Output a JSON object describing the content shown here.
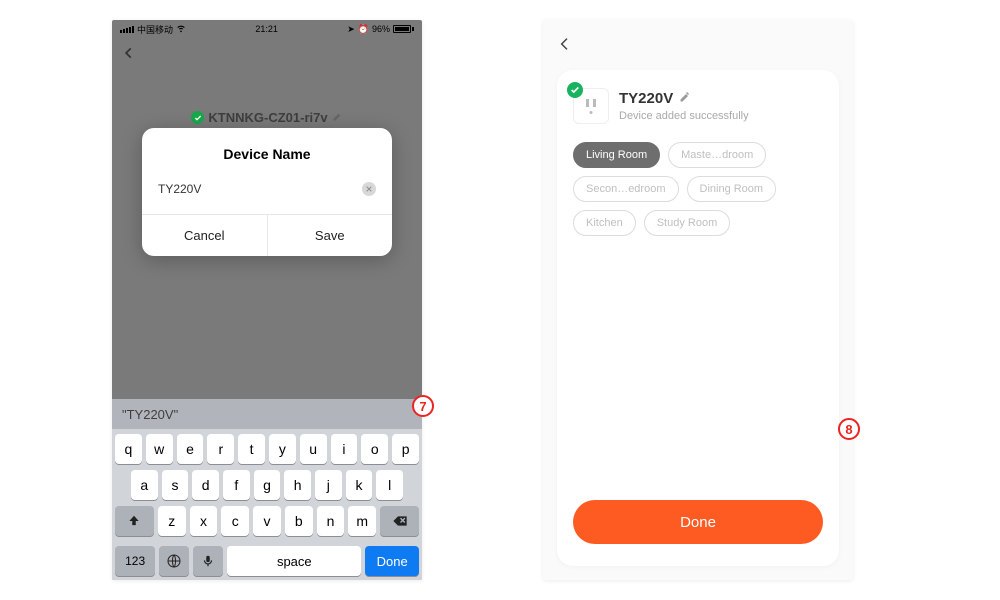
{
  "left": {
    "status": {
      "carrier": "中国移动",
      "time": "21:21",
      "battery_pct": "96%"
    },
    "bg_device_label": "KTNNKG-CZ01-ri7v",
    "modal": {
      "title": "Device Name",
      "value": "TY220V",
      "cancel": "Cancel",
      "save": "Save"
    },
    "keyboard": {
      "prediction": "\"TY220V\"",
      "row1": [
        "q",
        "w",
        "e",
        "r",
        "t",
        "y",
        "u",
        "i",
        "o",
        "p"
      ],
      "row2": [
        "a",
        "s",
        "d",
        "f",
        "g",
        "h",
        "j",
        "k",
        "l"
      ],
      "row3_letters": [
        "z",
        "x",
        "c",
        "v",
        "b",
        "n",
        "m"
      ],
      "num_key": "123",
      "space": "space",
      "done": "Done"
    }
  },
  "right": {
    "device_name": "TY220V",
    "device_sub": "Device added successfully",
    "rooms": [
      "Living Room",
      "Maste…droom",
      "Secon…edroom",
      "Dining Room",
      "Kitchen",
      "Study Room"
    ],
    "selected_room_index": 0,
    "done": "Done"
  },
  "steps": {
    "seven": "7",
    "eight": "8"
  }
}
